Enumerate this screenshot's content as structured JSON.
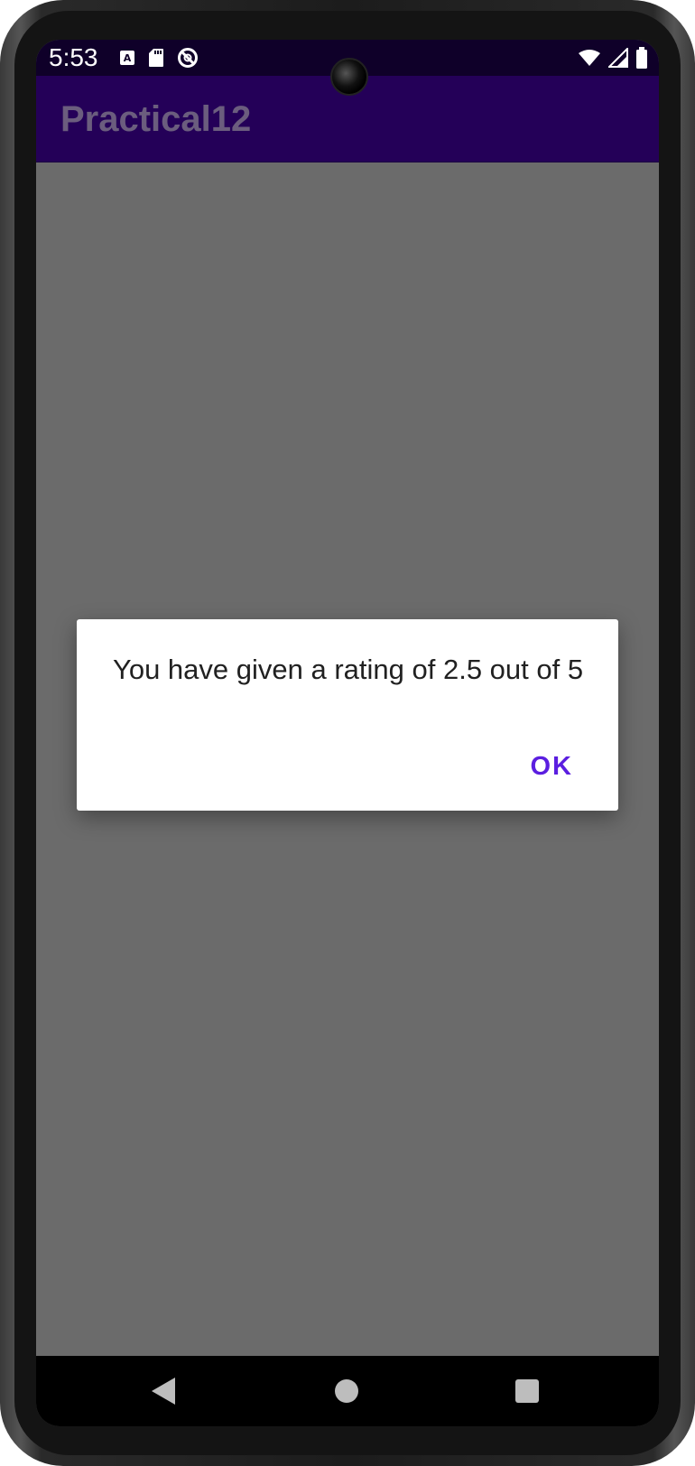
{
  "status_bar": {
    "time": "5:53",
    "icons_left": [
      "text-a-icon",
      "sd-card-icon",
      "do-not-disturb-icon"
    ],
    "icons_right": [
      "wifi-icon",
      "cell-signal-icon",
      "battery-icon"
    ]
  },
  "app_bar": {
    "title": "Practical12"
  },
  "dialog": {
    "message": "You have given a rating of 2.5 out of 5",
    "ok_label": "OK"
  },
  "nav_bar": {
    "icons": [
      "back-icon",
      "home-icon",
      "recents-icon"
    ]
  },
  "colors": {
    "status_bar": "#0f0029",
    "app_bar": "#240058",
    "scrim": "#6b6b6b",
    "dialog_button": "#5b1ee0"
  }
}
